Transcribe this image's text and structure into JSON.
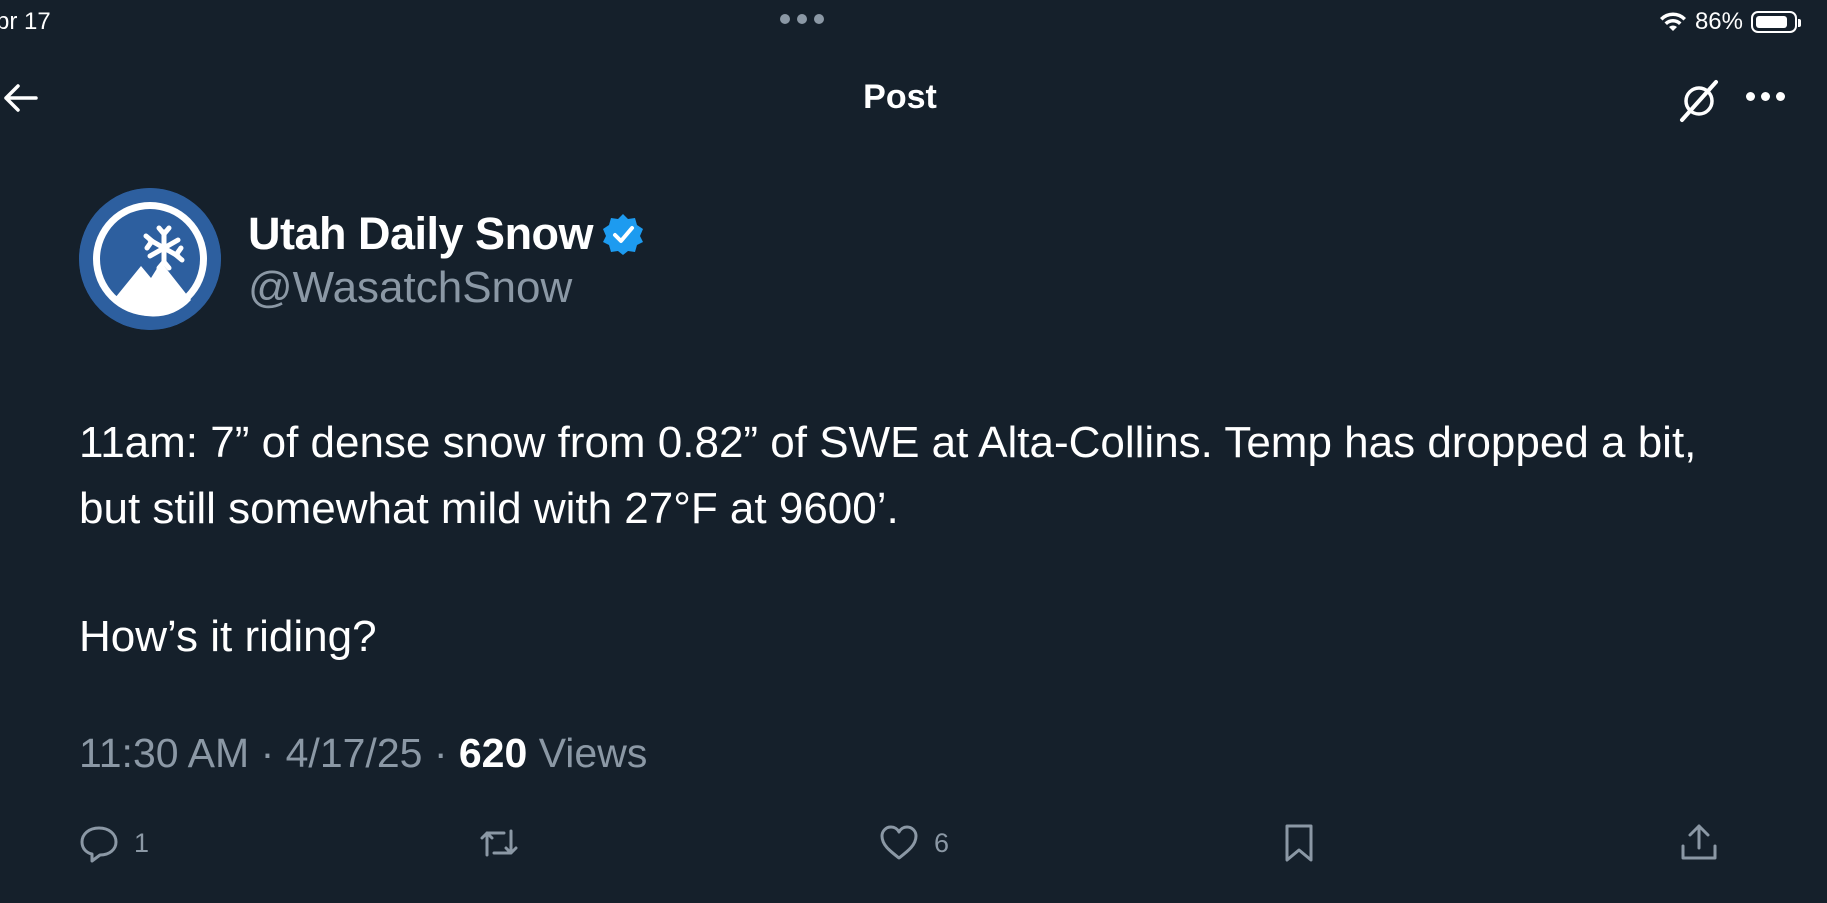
{
  "status_bar": {
    "date": "pr 17",
    "battery_percent": "86%",
    "battery_level": 0.86
  },
  "header": {
    "title": "Post"
  },
  "author": {
    "name": "Utah Daily Snow",
    "handle": "@WasatchSnow",
    "verified": true
  },
  "tweet": {
    "text": "11am: 7” of dense snow from 0.82” of SWE at Alta-Collins. Temp has dropped a bit, but still somewhat mild with 27°F at 9600’.",
    "question": "How’s it riding?",
    "time": "11:30 AM",
    "date": "4/17/25",
    "separator": " · ",
    "views_count": "620",
    "views_label": "Views"
  },
  "actions": {
    "reply_count": "1",
    "like_count": "6"
  },
  "colors": {
    "background": "#15202b",
    "text": "#ffffff",
    "muted": "#8b98a5",
    "verified": "#1d9bf0",
    "avatar": "#2d5f9f"
  },
  "icons": [
    "back-arrow-icon",
    "grok-icon",
    "more-icon",
    "verified-icon",
    "reply-icon",
    "retweet-icon",
    "like-icon",
    "bookmark-icon",
    "share-icon",
    "wifi-icon",
    "battery-icon"
  ]
}
